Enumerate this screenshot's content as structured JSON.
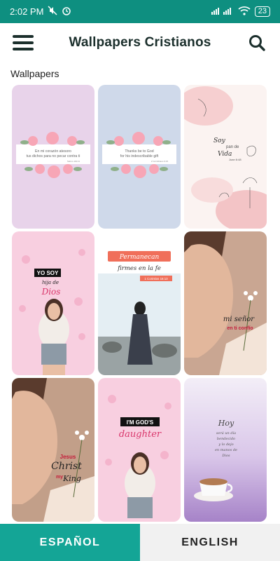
{
  "status": {
    "time": "2:02 PM",
    "battery": "23"
  },
  "app_bar": {
    "title": "Wallpapers Cristianos"
  },
  "section": {
    "label": "Wallpapers"
  },
  "wallpapers": [
    {
      "texts": [
        "En mi corazón atesoro",
        "tus dichos para no pecar contra ti",
        "Salmo 119:11"
      ]
    },
    {
      "texts": [
        "Thanks be to God",
        "for his indescribable gift",
        "2 Corinthians 9:15"
      ]
    },
    {
      "texts": [
        "Soy",
        "pan de",
        "Vida",
        "Juan 6:48"
      ]
    },
    {
      "texts": [
        "YO SOY",
        "hija de",
        "Dios"
      ]
    },
    {
      "texts": [
        "Permanecan",
        "firmes en la fe",
        "1 Corintios 16:13"
      ]
    },
    {
      "texts": [
        "mi señor",
        "en ti confío"
      ]
    },
    {
      "texts": [
        "Jesus",
        "Christ",
        "my",
        "King"
      ]
    },
    {
      "texts": [
        "I'M GOD'S",
        "daughter"
      ]
    },
    {
      "texts": [
        "Hoy",
        "será un día",
        "bendecido",
        "y lo dejo",
        "en manos de",
        "Dios"
      ]
    }
  ],
  "tabs": {
    "spanish": "ESPAÑOL",
    "english": "ENGLISH"
  }
}
